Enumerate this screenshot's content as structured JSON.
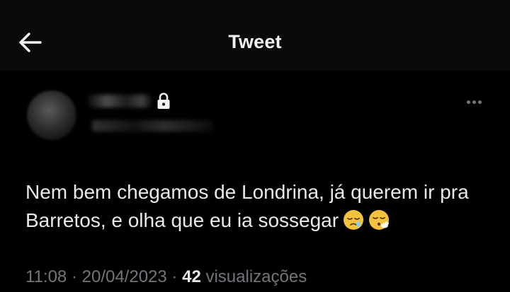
{
  "header": {
    "title": "Tweet",
    "back_icon": "arrow-left-icon"
  },
  "author": {
    "protected_icon": "lock-icon"
  },
  "tweet": {
    "text": "Nem bem chegamos de Londrina, já querem ir pra Barretos, e olha que eu ia sossegar",
    "emojis": [
      "sleepy-face-emoji",
      "face-exhaling-emoji"
    ]
  },
  "meta": {
    "time": "11:08",
    "separator": "·",
    "date": "20/04/2023",
    "views_count": "42",
    "views_label": "visualizações"
  },
  "colors": {
    "background": "#000000",
    "header_background": "#0a0a0a",
    "text_primary": "#e7e9ea",
    "text_secondary": "#71767b",
    "emoji_yellow": "#f5c33b"
  }
}
